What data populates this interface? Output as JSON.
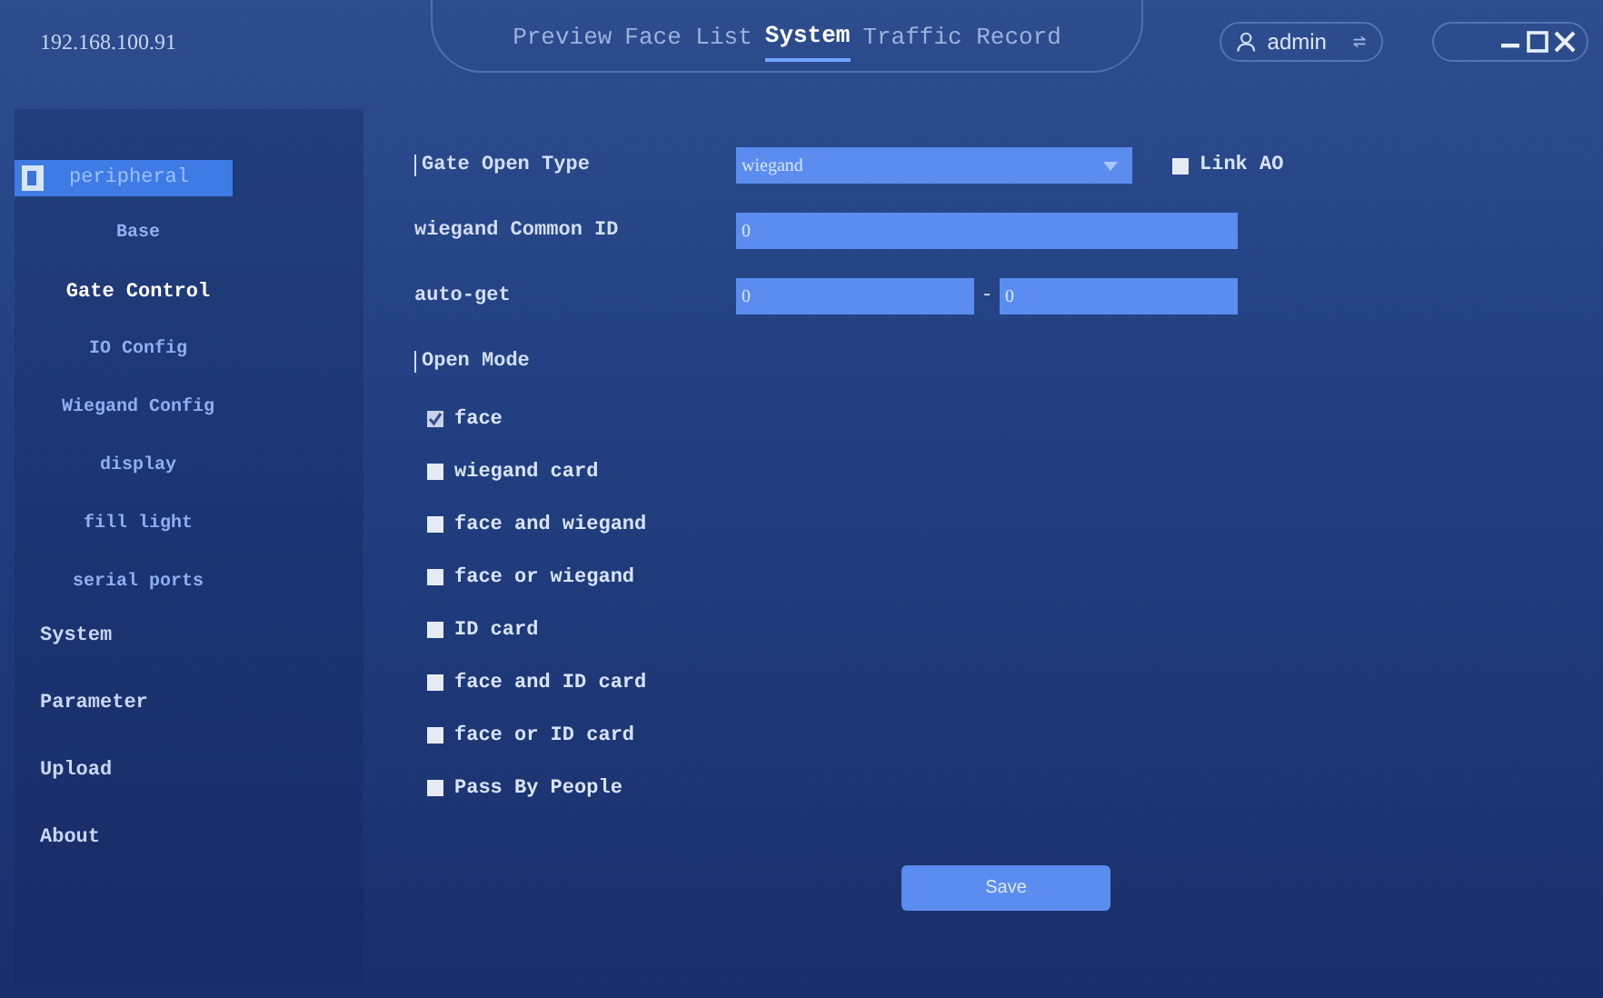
{
  "header": {
    "address": "192.168.100.91",
    "nav": [
      {
        "label": "Preview",
        "selected": false
      },
      {
        "label": "Face List",
        "selected": false
      },
      {
        "label": "System",
        "selected": true
      },
      {
        "label": "Traffic Record",
        "selected": false
      }
    ],
    "user": "admin"
  },
  "sidebar": {
    "items": [
      {
        "label": "peripheral",
        "selected": true,
        "children": [
          {
            "label": "Base",
            "selected": false
          },
          {
            "label": "Gate Control",
            "selected": true
          },
          {
            "label": "IO Config",
            "selected": false
          },
          {
            "label": "Wiegand Config",
            "selected": false
          },
          {
            "label": "display",
            "selected": false
          },
          {
            "label": "fill light",
            "selected": false
          },
          {
            "label": "serial ports",
            "selected": false
          }
        ]
      },
      {
        "label": "System",
        "selected": false
      },
      {
        "label": "Parameter",
        "selected": false
      },
      {
        "label": "Upload",
        "selected": false
      },
      {
        "label": "About",
        "selected": false
      }
    ]
  },
  "form": {
    "gate_open_type": {
      "label": "Gate Open Type",
      "value": "wiegand"
    },
    "link_ao": {
      "label": "Link AO",
      "checked": false
    },
    "wiegand_common_id": {
      "label": "wiegand Common ID",
      "value": "0"
    },
    "auto_get": {
      "label": "auto-get",
      "from": "0",
      "separator": "-",
      "to": "0"
    },
    "open_mode": {
      "label": "Open Mode",
      "options": [
        {
          "label": "face",
          "checked": true
        },
        {
          "label": "wiegand card",
          "checked": false
        },
        {
          "label": "face and wiegand",
          "checked": false
        },
        {
          "label": "face or wiegand",
          "checked": false
        },
        {
          "label": "ID card",
          "checked": false
        },
        {
          "label": "face and ID card",
          "checked": false
        },
        {
          "label": "face or ID card",
          "checked": false
        },
        {
          "label": "Pass By People",
          "checked": false
        }
      ]
    },
    "save": "Save"
  }
}
